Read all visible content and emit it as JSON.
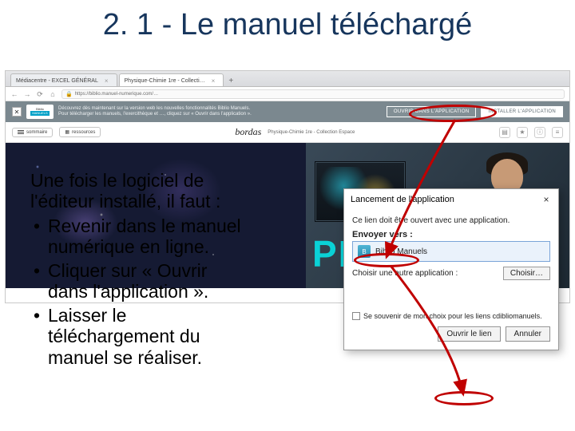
{
  "title": "2. 1 - Le manuel téléchargé",
  "browser": {
    "tabs": [
      {
        "label": "Médiacentre - EXCEL GÉNÉRAL"
      },
      {
        "label": "Physique-Chimie 1re - Collecti…"
      }
    ],
    "url": "https://biblio.manuel-numerique.com/…",
    "banner": {
      "line1": "Découvrez dès maintenant sur la version web les nouvelles fonctionnalités Biblio Manuels.",
      "line2": "Pour télécharger les manuels, l'exercithèque et …, cliquez sur « Ouvrir dans l'application ».",
      "open_label": "OUVRIR DANS L'APPLICATION",
      "install_label": "INSTALLER L'APPLICATION"
    },
    "toolbar": {
      "sommaire": "sommaire",
      "ressources": "ressources",
      "publisher": "bordas",
      "book": "Physique-Chimie 1re - Collection Espace"
    },
    "hero_text": "PHY"
  },
  "dialog": {
    "title": "Lancement de l'application",
    "line1": "Ce lien doit être ouvert avec une application.",
    "envoyer": "Envoyer vers :",
    "app": "Biblio Manuels",
    "choose_label": "Choisir une autre application :",
    "choose_btn": "Choisir…",
    "remember": "Se souvenir de mon choix pour les liens cdibliomanuels.",
    "ok": "Ouvrir le lien",
    "cancel": "Annuler"
  },
  "body_text": {
    "intro1": "Une fois le logiciel de",
    "intro2": "l'éditeur installé, il faut :",
    "b1a": "Revenir dans le manuel",
    "b1b": "numérique en ligne.",
    "b2a": "Cliquer sur « Ouvrir",
    "b2b": "dans l'application ».",
    "b3a": "Laisser le",
    "b3b": "téléchargement du",
    "b3c": "manuel se réaliser."
  }
}
